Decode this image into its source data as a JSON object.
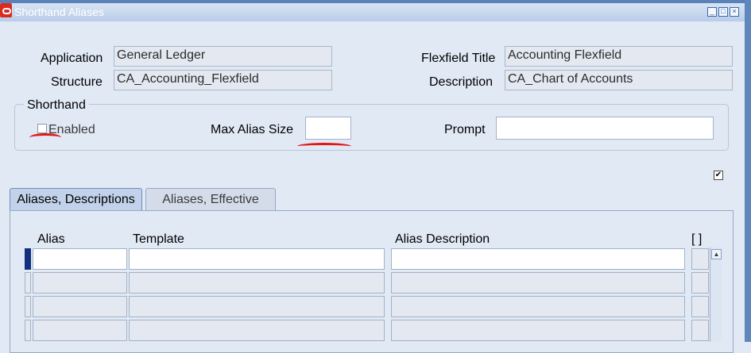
{
  "window": {
    "title": "Shorthand Aliases",
    "controls": [
      "minimize",
      "maximize",
      "close"
    ]
  },
  "header": {
    "application_label": "Application",
    "application_value": "General Ledger",
    "structure_label": "Structure",
    "structure_value": "CA_Accounting_Flexfield",
    "flexfield_title_label": "Flexfield Title",
    "flexfield_title_value": "Accounting Flexfield",
    "description_label": "Description",
    "description_value": "CA_Chart of Accounts"
  },
  "shorthand": {
    "group_label": "Shorthand",
    "enabled_label": "Enabled",
    "enabled_checked": false,
    "max_alias_size_label": "Max Alias Size",
    "max_alias_size_value": "",
    "prompt_label": "Prompt",
    "prompt_value": ""
  },
  "standalone_checkbox": {
    "checked": true,
    "glyph": "✔"
  },
  "tabs": [
    {
      "label": "Aliases, Descriptions",
      "active": true
    },
    {
      "label": "Aliases, Effective",
      "active": false
    }
  ],
  "table": {
    "columns": [
      "Alias",
      "Template",
      "Alias Description",
      "[ ]"
    ],
    "rows": [
      {
        "alias": "",
        "template": "",
        "alias_description": ""
      },
      {
        "alias": "",
        "template": "",
        "alias_description": ""
      },
      {
        "alias": "",
        "template": "",
        "alias_description": ""
      },
      {
        "alias": "",
        "template": "",
        "alias_description": ""
      }
    ]
  },
  "colors": {
    "background": "#e1e9f5",
    "annotation_red": "#e01818",
    "current_record": "#13307e"
  }
}
